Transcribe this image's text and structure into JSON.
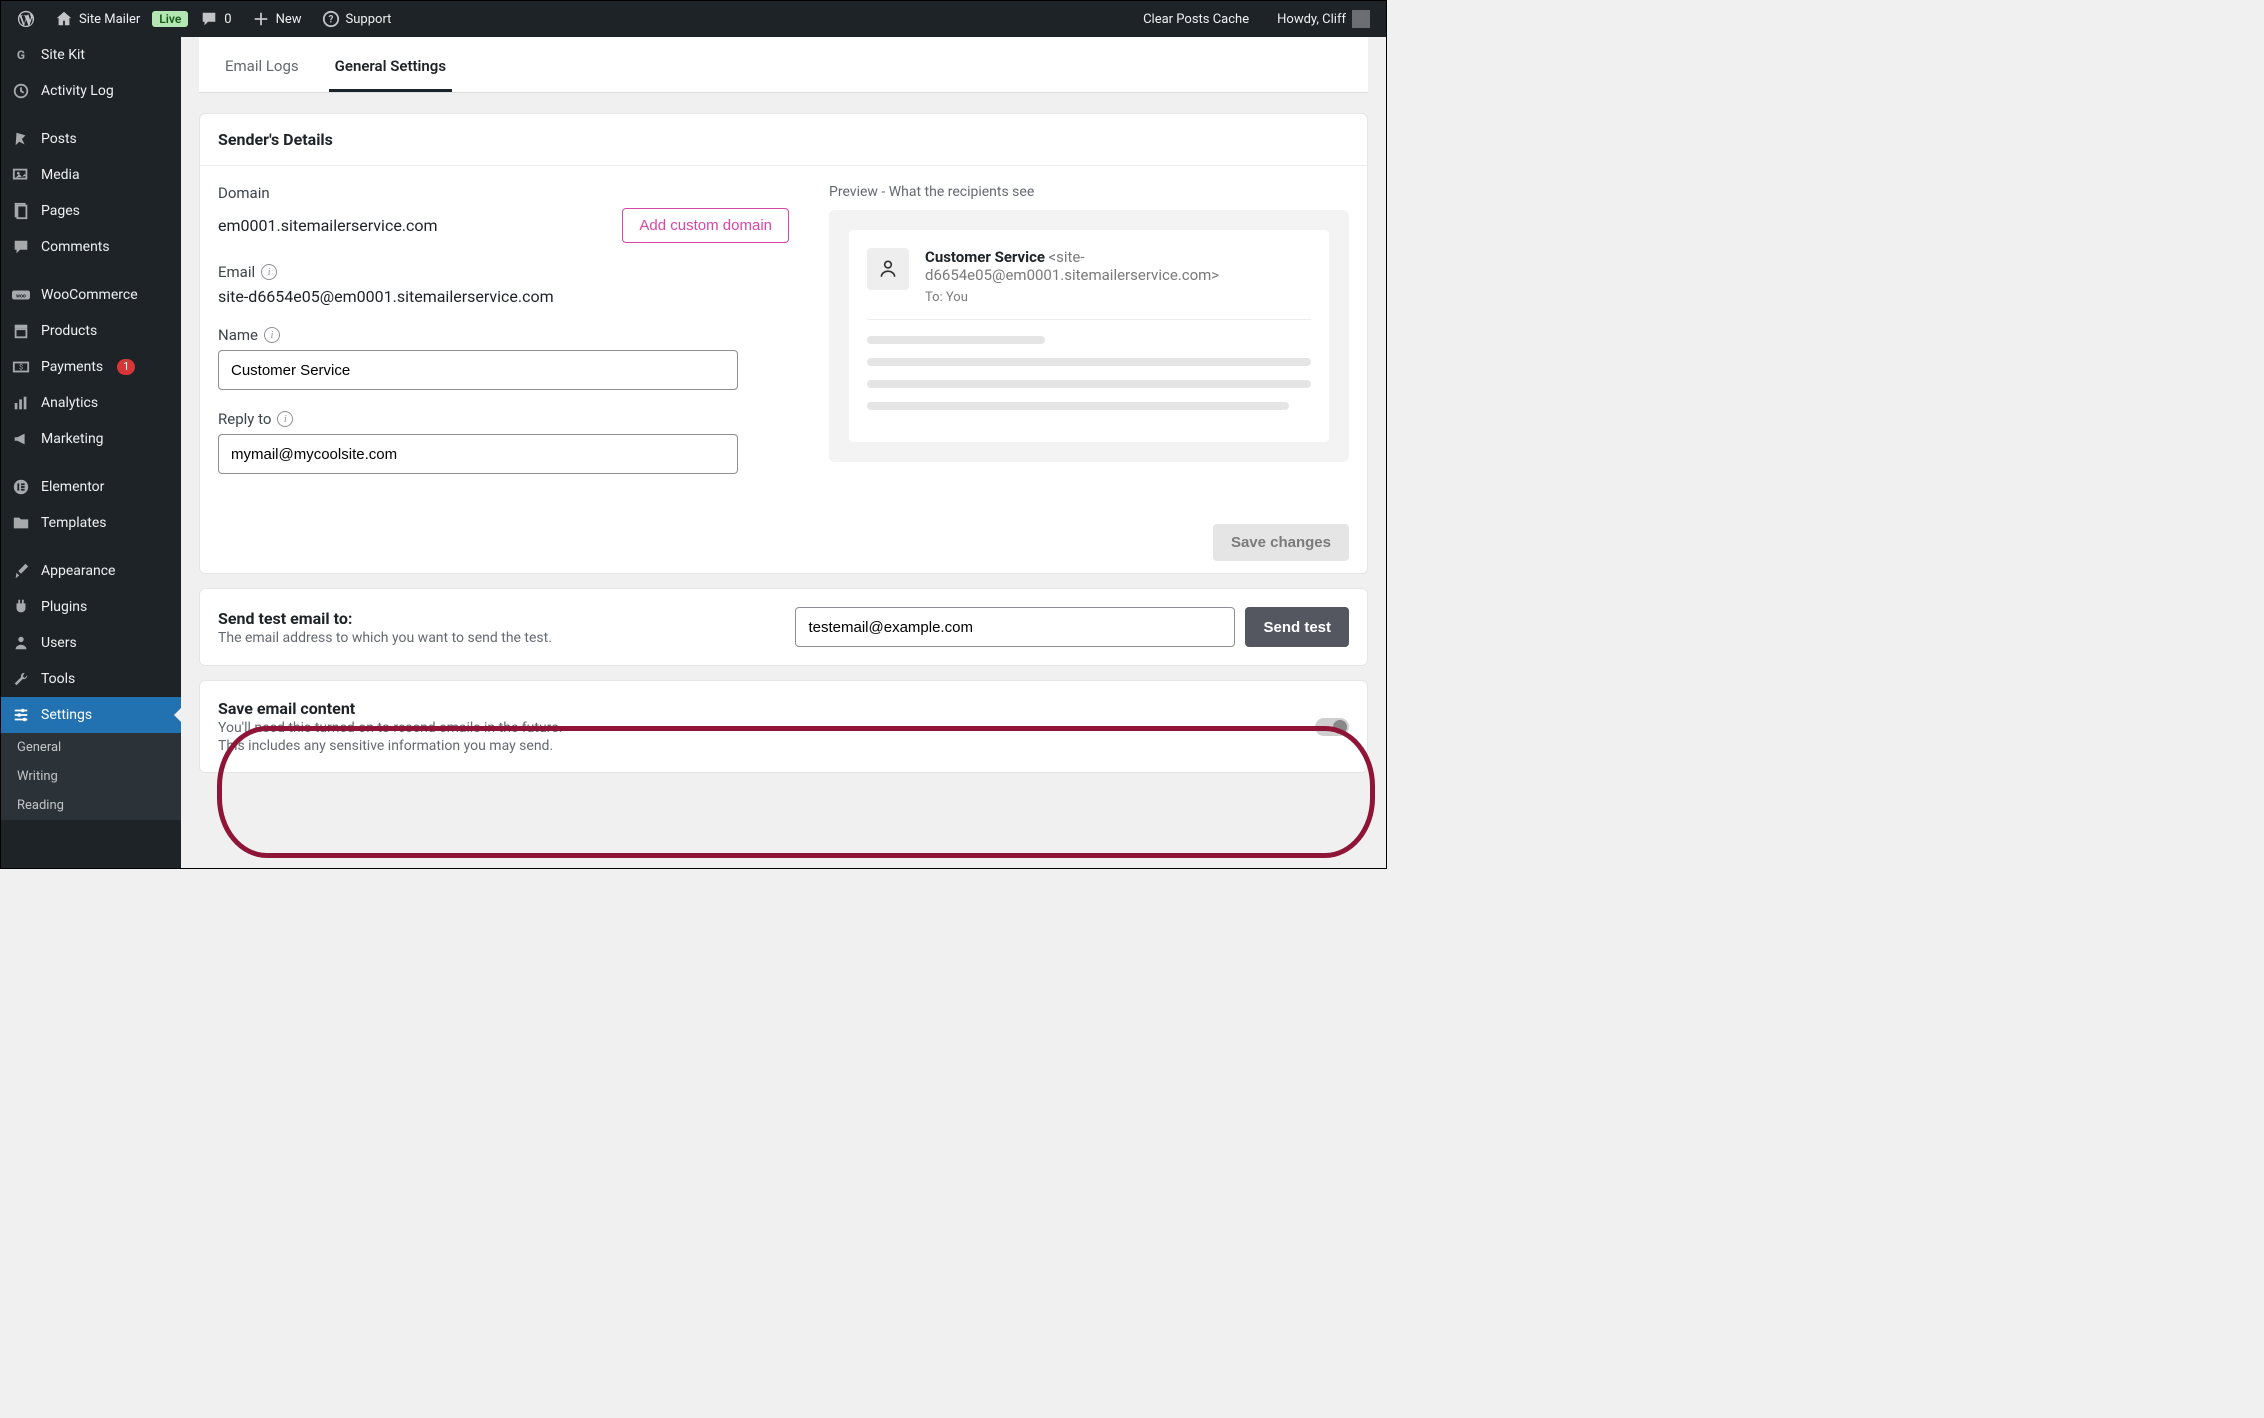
{
  "adminbar": {
    "siteName": "Site Mailer",
    "liveBadge": "Live",
    "commentCount": "0",
    "newLabel": "New",
    "supportLabel": "Support",
    "clearCacheLabel": "Clear Posts Cache",
    "greeting": "Howdy, Cliff"
  },
  "sidebar": {
    "items": [
      {
        "label": "Site Kit"
      },
      {
        "label": "Activity Log"
      },
      {
        "label": "Posts"
      },
      {
        "label": "Media"
      },
      {
        "label": "Pages"
      },
      {
        "label": "Comments"
      },
      {
        "label": "WooCommerce"
      },
      {
        "label": "Products"
      },
      {
        "label": "Payments",
        "badge": "1"
      },
      {
        "label": "Analytics"
      },
      {
        "label": "Marketing"
      },
      {
        "label": "Elementor"
      },
      {
        "label": "Templates"
      },
      {
        "label": "Appearance"
      },
      {
        "label": "Plugins"
      },
      {
        "label": "Users"
      },
      {
        "label": "Tools"
      },
      {
        "label": "Settings"
      }
    ],
    "submenu": [
      "General",
      "Writing",
      "Reading"
    ]
  },
  "tabs": {
    "emailLogs": "Email Logs",
    "generalSettings": "General Settings"
  },
  "sender": {
    "header": "Sender's Details",
    "domainLabel": "Domain",
    "domainValue": "em0001.sitemailerservice.com",
    "addCustom": "Add custom domain",
    "emailLabel": "Email",
    "emailValue": "site-d6654e05@em0001.sitemailerservice.com",
    "nameLabel": "Name",
    "nameValue": "Customer Service",
    "replyLabel": "Reply to",
    "replyValue": "mymail@mycoolsite.com",
    "saveChanges": "Save changes"
  },
  "preview": {
    "label": "Preview - What the recipients see",
    "fromName": "Customer Service",
    "fromAddr": "<site-d6654e05@em0001.sitemailerservice.com>",
    "to": "To: You"
  },
  "test": {
    "title": "Send test email to:",
    "subtitle": "The email address to which you want to send the test.",
    "value": "testemail@example.com",
    "button": "Send test"
  },
  "saveContent": {
    "title": "Save email content",
    "line1": "You'll need this turned on to resend emails in the future.",
    "line2": "This includes any sensitive information you may send."
  }
}
